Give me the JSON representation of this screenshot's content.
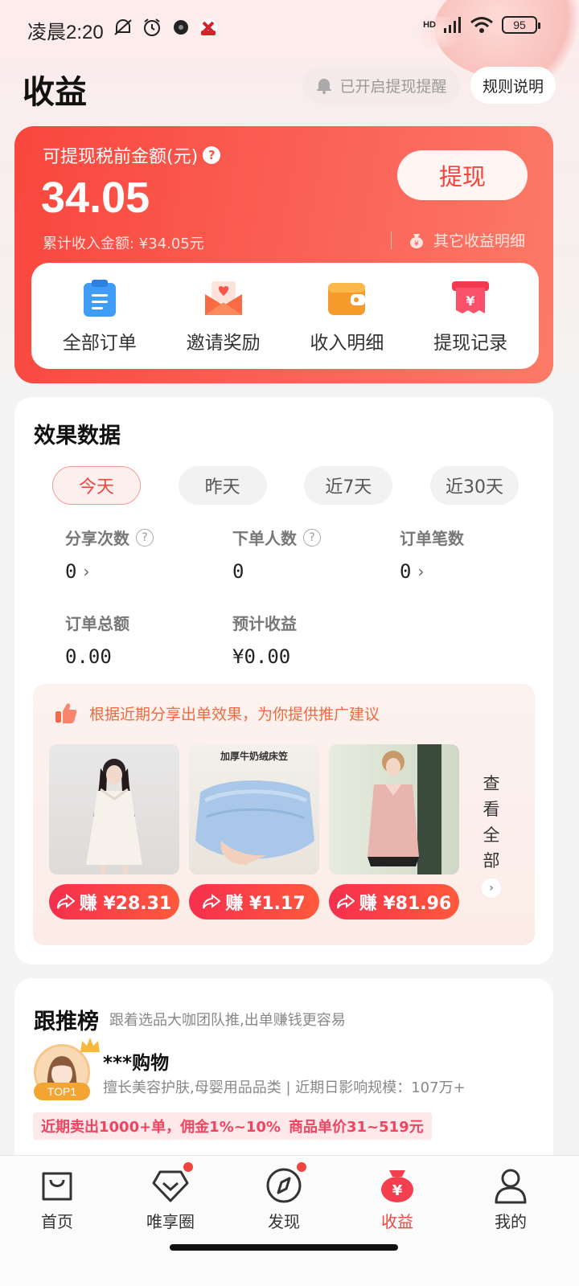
{
  "status_bar": {
    "time": "凌晨2:20",
    "signal": "HD",
    "battery": "95"
  },
  "header": {
    "title": "收益",
    "remind_label": "已开启提现提醒",
    "rules_label": "规则说明"
  },
  "earnings": {
    "label": "可提现税前金额(元)",
    "amount": "34.05",
    "cumulative": "累计收入金额: ¥34.05元",
    "withdraw_label": "提现",
    "other_detail": "其它收益明细",
    "shortcuts": [
      {
        "label": "全部订单",
        "icon": "clipboard-icon"
      },
      {
        "label": "邀请奖励",
        "icon": "envelope-icon"
      },
      {
        "label": "收入明细",
        "icon": "wallet-icon"
      },
      {
        "label": "提现记录",
        "icon": "yuan-receipt-icon"
      }
    ]
  },
  "stats": {
    "title": "效果数据",
    "periods": [
      "今天",
      "昨天",
      "近7天",
      "近30天"
    ],
    "active_period": "今天",
    "metrics": {
      "shares": {
        "label": "分享次数",
        "value": "0"
      },
      "buyers": {
        "label": "下单人数",
        "value": "0"
      },
      "orders": {
        "label": "订单笔数",
        "value": "0"
      },
      "total": {
        "label": "订单总额",
        "value": "0.00"
      },
      "estimate": {
        "label": "预计收益",
        "value": "¥0.00"
      }
    },
    "suggestion": {
      "text": "根据近期分享出单效果，为你提供推广建议",
      "products": [
        {
          "earn": "赚 ¥28.31"
        },
        {
          "earn": "赚 ¥1.17",
          "caption": "加厚牛奶绒床笠"
        },
        {
          "earn": "赚 ¥81.96"
        }
      ],
      "view_all": [
        "查",
        "看",
        "全",
        "部"
      ]
    }
  },
  "follow": {
    "title": "跟推榜",
    "subtitle": "跟着选品大咖团队推,出单赚钱更容易",
    "badge": "TOP1",
    "name": "***购物",
    "desc": "擅长美容护肤,母婴用品品类  |  近期日影响规模：107万+",
    "tags": [
      "近期卖出1000+单，佣金1%~10%",
      "商品单价31~519元"
    ]
  },
  "tabbar": {
    "items": [
      {
        "label": "首页",
        "icon": "bag-icon"
      },
      {
        "label": "唯享圈",
        "icon": "diamond-chat-icon"
      },
      {
        "label": "发现",
        "icon": "compass-icon"
      },
      {
        "label": "收益",
        "icon": "money-bag-icon"
      },
      {
        "label": "我的",
        "icon": "person-icon"
      }
    ],
    "active": "收益",
    "accent": "#f0443c"
  }
}
